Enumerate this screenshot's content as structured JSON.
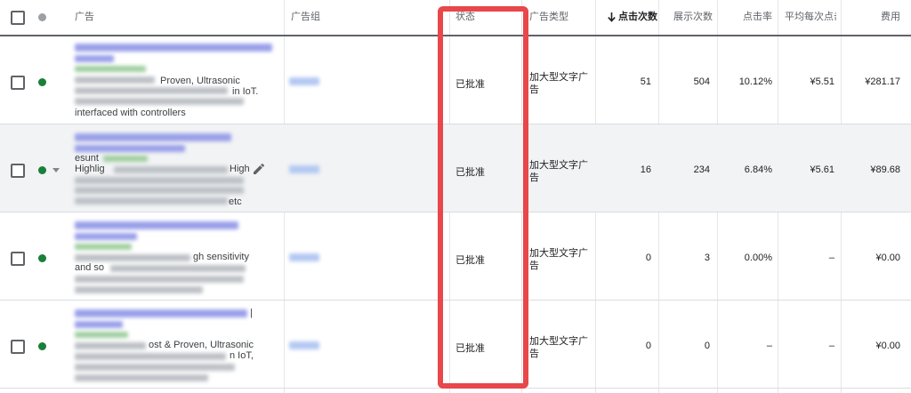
{
  "header": {
    "ad": "广告",
    "ad_group": "广告组",
    "status": "状态",
    "ad_type": "广告类型",
    "clicks": "点击次数",
    "impressions": "展示次数",
    "ctr": "点击率",
    "avg_cpc": "平均每次点击费用",
    "cost": "费用"
  },
  "colors": {
    "status_green": "#188038",
    "highlight_box": "#e8474b",
    "header_text": "#5f6368"
  },
  "icons": {
    "sort": "arrow-down-icon",
    "edit": "pencil-icon",
    "expand": "caret-down-icon"
  },
  "rows": [
    {
      "desc": [
        "Proven, Ultrasonic",
        "in IoT.",
        "interfaced with controllers"
      ],
      "status": "已批准",
      "ad_type": "加大型文字广告",
      "clicks": "51",
      "impressions": "504",
      "ctr": "10.12%",
      "avg_cpc": "¥5.51",
      "cost": "¥281.17"
    },
    {
      "desc": [
        "esunt",
        "Highlig",
        "High",
        "etc"
      ],
      "status": "已批准",
      "ad_type": "加大型文字广告",
      "clicks": "16",
      "impressions": "234",
      "ctr": "6.84%",
      "avg_cpc": "¥5.61",
      "cost": "¥89.68"
    },
    {
      "desc": [
        "gh sensitivity",
        "and so"
      ],
      "status": "已批准",
      "ad_type": "加大型文字广告",
      "clicks": "0",
      "impressions": "3",
      "ctr": "0.00%",
      "avg_cpc": "–",
      "cost": "¥0.00"
    },
    {
      "desc": [
        "|",
        "ost & Proven, Ultrasonic",
        "n IoT,"
      ],
      "status": "已批准",
      "ad_type": "加大型文字广告",
      "clicks": "0",
      "impressions": "0",
      "ctr": "–",
      "avg_cpc": "–",
      "cost": "¥0.00"
    }
  ]
}
